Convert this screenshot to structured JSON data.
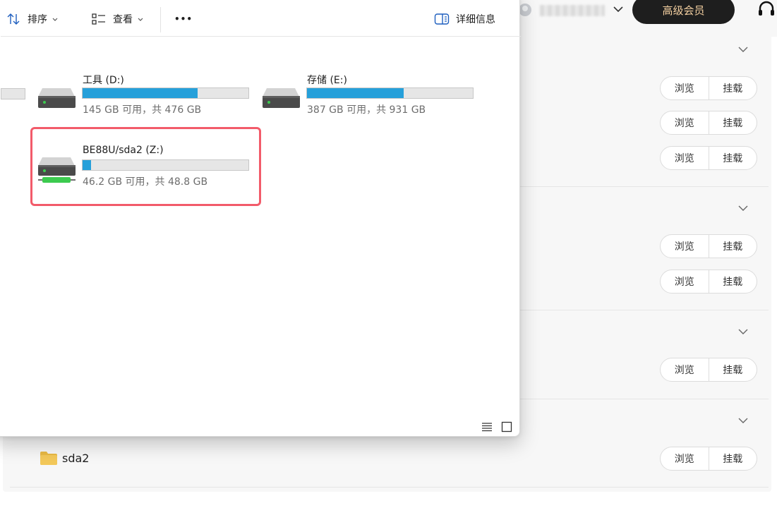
{
  "toolbar": {
    "sort_label": "排序",
    "view_label": "查看",
    "more_label": "•••",
    "details_label": "详细信息"
  },
  "drives": [
    {
      "name": "工具 (D:)",
      "free_text": "145 GB 可用，共 476 GB",
      "used_fraction": 0.695
    },
    {
      "name": "存储 (E:)",
      "free_text": "387 GB 可用，共 931 GB",
      "used_fraction": 0.584
    },
    {
      "name": "BE88U/sda2 (Z:)",
      "free_text": "46.2 GB 可用，共 48.8 GB",
      "used_fraction": 0.053
    }
  ],
  "background_app": {
    "vip_button_label": "高级会员",
    "browse_label": "浏览",
    "mount_label": "挂载",
    "folder_name": "sda2"
  },
  "colors": {
    "usage_bar": "#26a0da",
    "highlight": "#f25b6a",
    "vip_text": "#f3cfa0",
    "network_drive_accent": "#3ccb4f"
  }
}
